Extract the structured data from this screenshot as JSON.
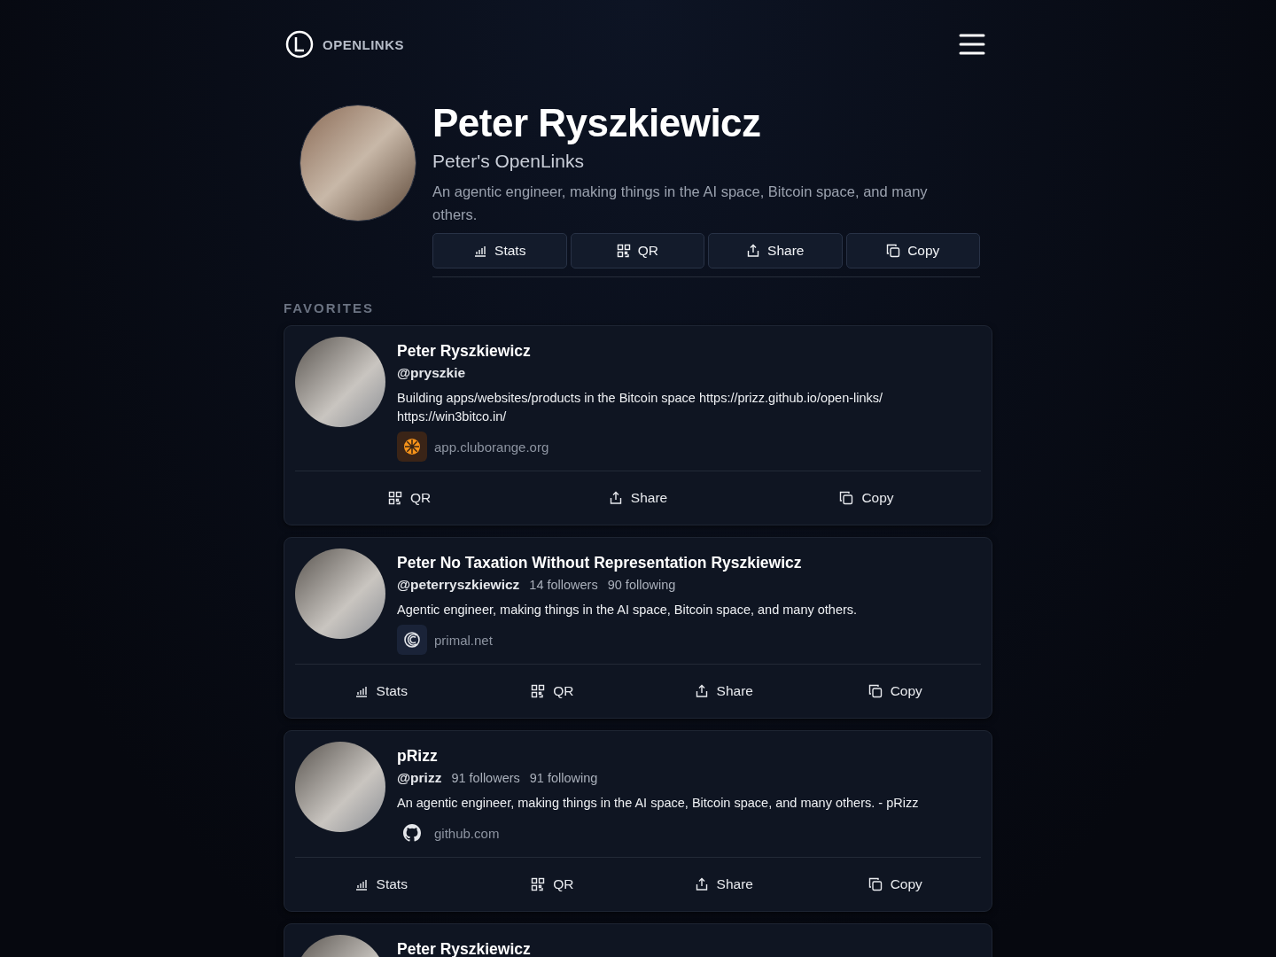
{
  "brand": {
    "name": "OPENLINKS"
  },
  "profile": {
    "name": "Peter Ryszkiewicz",
    "subtitle": "Peter's OpenLinks",
    "bio": "An agentic engineer, making things in the AI space, Bitcoin space, and many others.",
    "actions": [
      {
        "kind": "stats",
        "label": "Stats"
      },
      {
        "kind": "qr",
        "label": "QR"
      },
      {
        "kind": "share",
        "label": "Share"
      },
      {
        "kind": "copy",
        "label": "Copy"
      }
    ]
  },
  "favorites": {
    "heading": "FAVORITES",
    "cards": [
      {
        "name": "Peter Ryszkiewicz",
        "handle": "@pryszkie",
        "bio": "Building apps/websites/products in the Bitcoin space https://prizz.github.io/open-links/ https://win3bitco.in/",
        "site": {
          "kind": "cluborange",
          "label": "app.cluborange.org"
        },
        "actions": [
          {
            "kind": "qr",
            "label": "QR"
          },
          {
            "kind": "share",
            "label": "Share"
          },
          {
            "kind": "copy",
            "label": "Copy"
          }
        ]
      },
      {
        "name": "Peter No Taxation Without Representation Ryszkiewicz",
        "handle": "@peterryszkiewicz",
        "followers": "14 followers",
        "following": "90 following",
        "bio": "Agentic engineer, making things in the AI space, Bitcoin space, and many others.",
        "site": {
          "kind": "primal",
          "label": "primal.net"
        },
        "actions": [
          {
            "kind": "stats",
            "label": "Stats"
          },
          {
            "kind": "qr",
            "label": "QR"
          },
          {
            "kind": "share",
            "label": "Share"
          },
          {
            "kind": "copy",
            "label": "Copy"
          }
        ]
      },
      {
        "name": "pRizz",
        "handle": "@prizz",
        "followers": "91 followers",
        "following": "91 following",
        "bio": "An agentic engineer, making things in the AI space, Bitcoin space, and many others. - pRizz",
        "site": {
          "kind": "github",
          "label": "github.com"
        },
        "actions": [
          {
            "kind": "stats",
            "label": "Stats"
          },
          {
            "kind": "qr",
            "label": "QR"
          },
          {
            "kind": "share",
            "label": "Share"
          },
          {
            "kind": "copy",
            "label": "Copy"
          }
        ]
      },
      {
        "name": "Peter Ryszkiewicz"
      }
    ]
  }
}
